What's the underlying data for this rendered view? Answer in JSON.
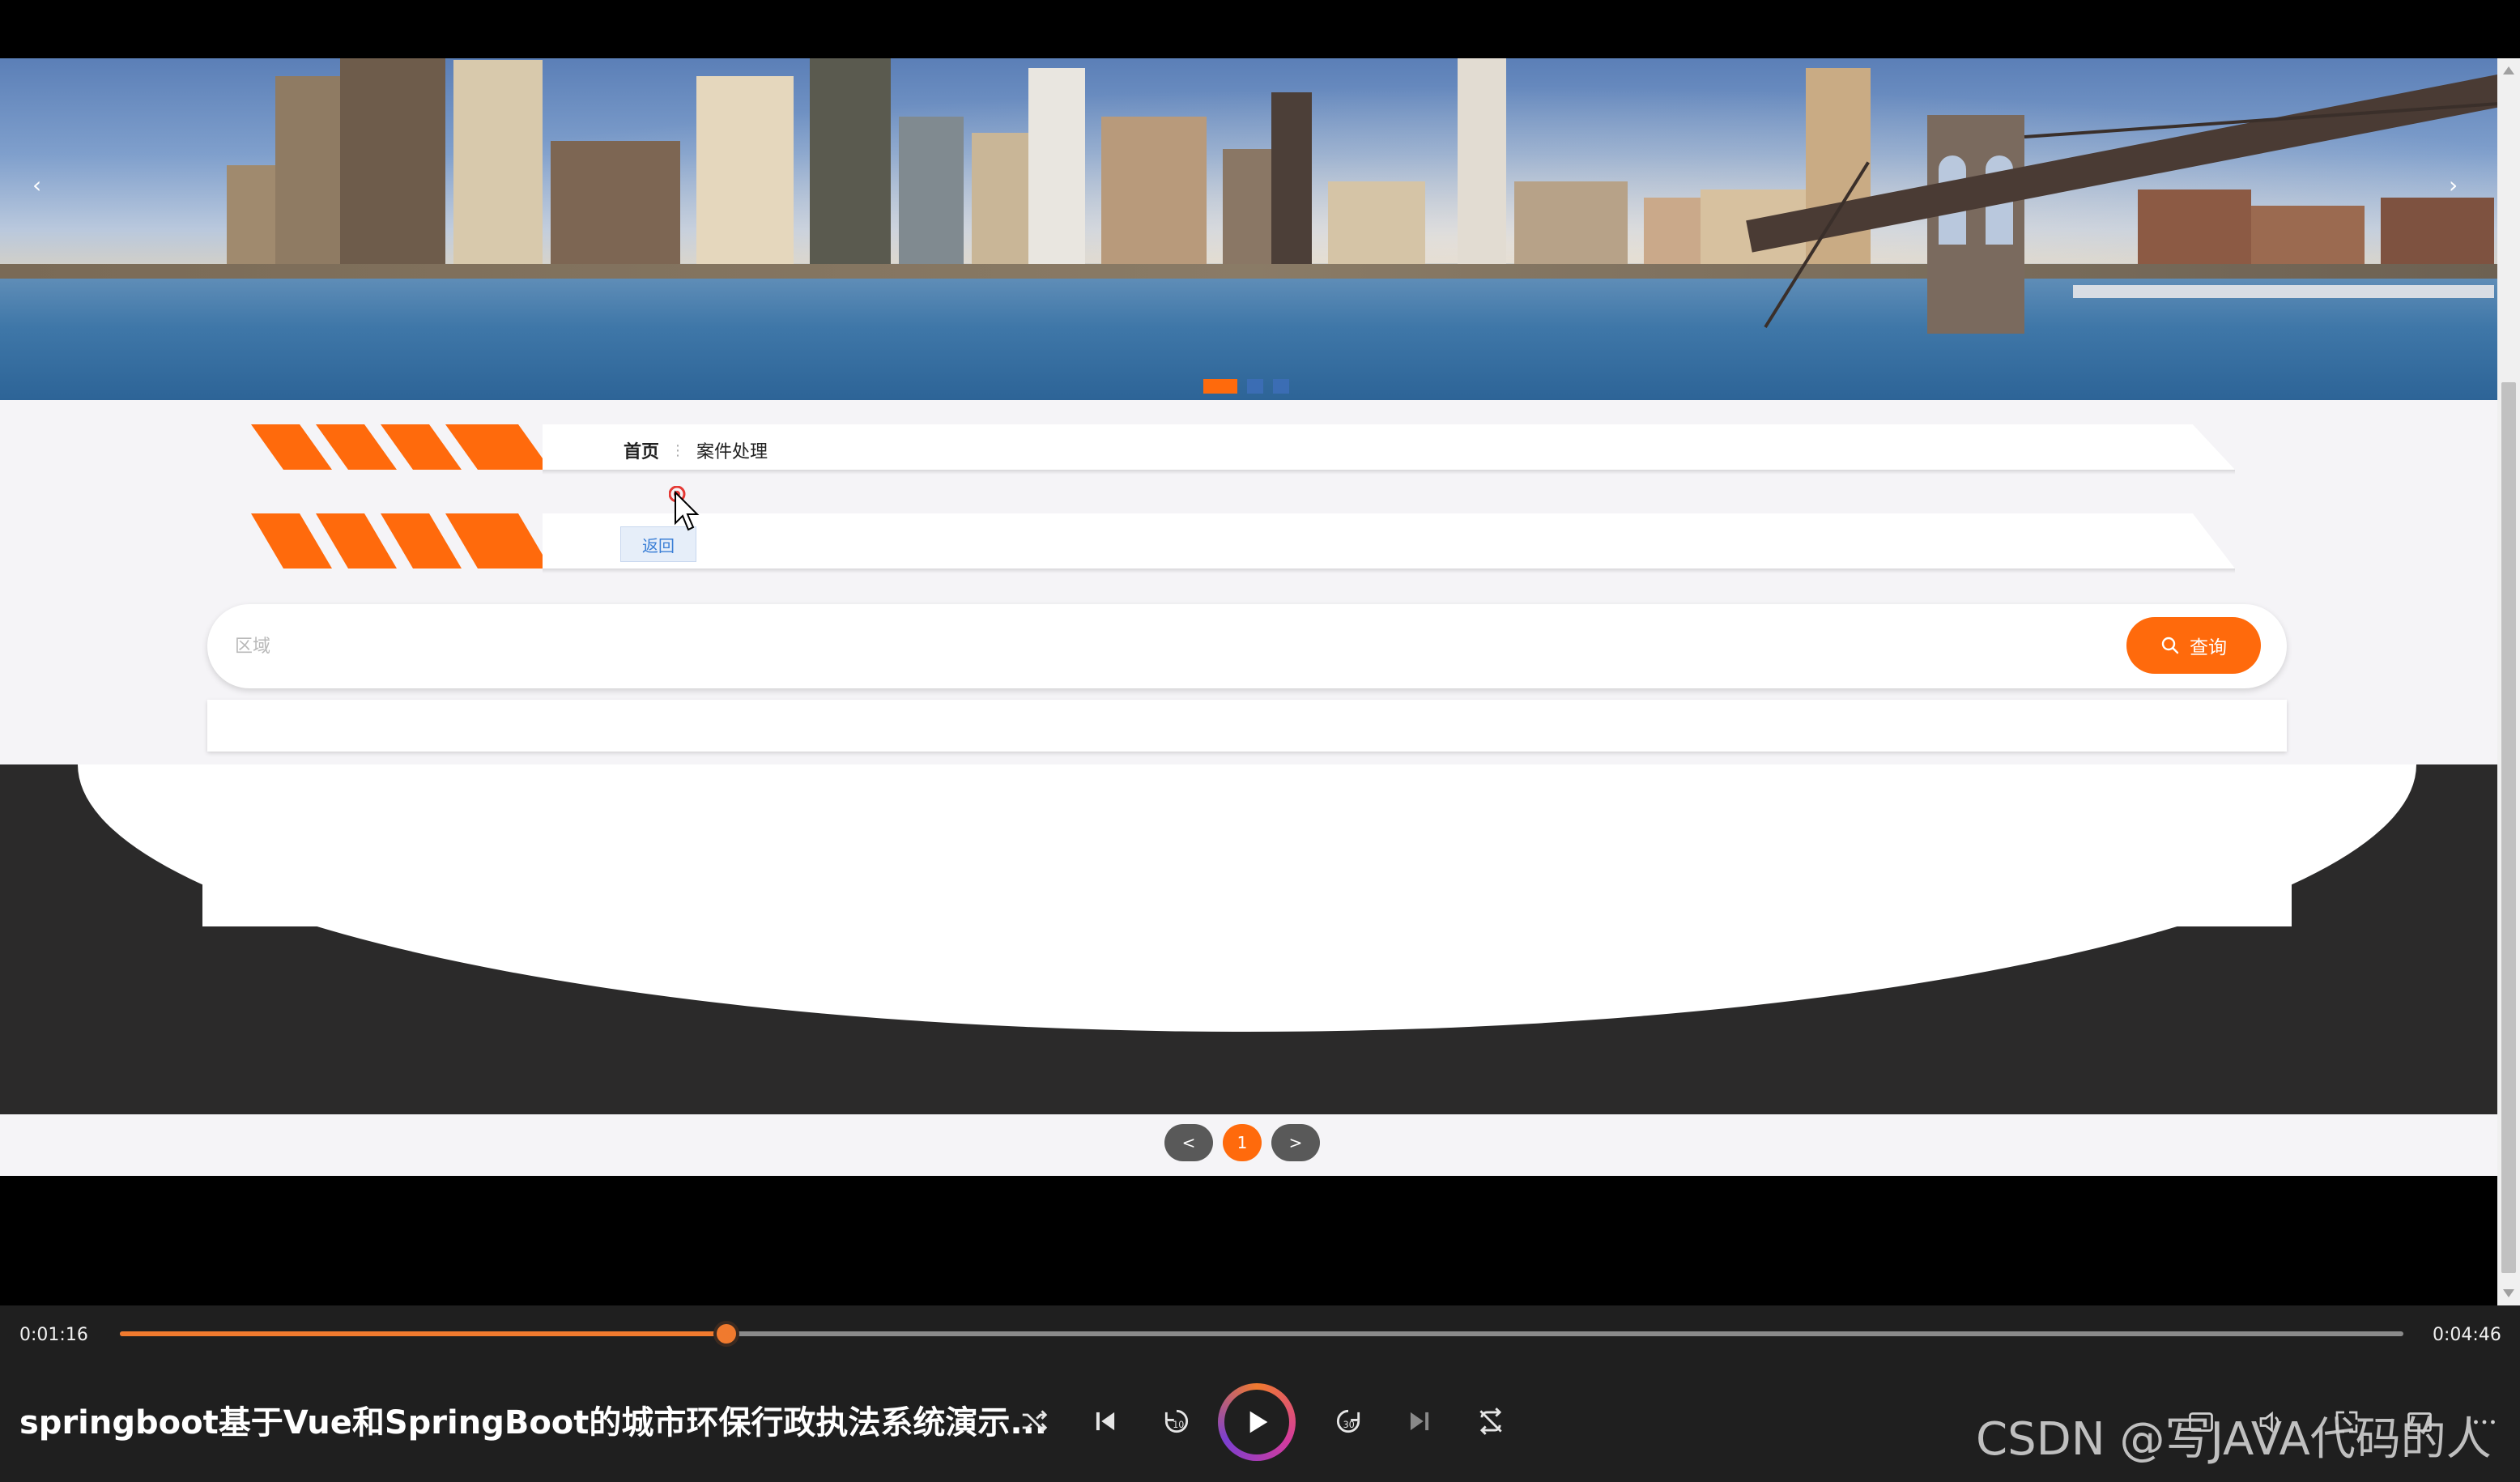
{
  "banner": {
    "prev_icon": "chevron-left-icon",
    "next_icon": "chevron-right-icon",
    "prev_symbol": "‹",
    "next_symbol": "›",
    "slides": 3,
    "active_slide": 1
  },
  "breadcrumb": {
    "home": "首页",
    "separator": "⋮",
    "current": "案件处理"
  },
  "toolbar": {
    "back_label": "返回"
  },
  "search": {
    "placeholder": "区域",
    "value": "",
    "button_label": "查询",
    "button_icon": "search-icon"
  },
  "pagination": {
    "prev": "<",
    "current_page": "1",
    "next": ">"
  },
  "player": {
    "elapsed": "0:01:16",
    "duration": "0:04:46",
    "progress": 0.2657,
    "title": "springboot基于Vue和SpringBoot的城市环保行政执法系统演示...",
    "watermark": "CSDN @写JAVA代码的人",
    "icons": [
      "shuffle-icon",
      "previous-icon",
      "rewind-10-icon",
      "play-icon",
      "forward-30-icon",
      "next-icon",
      "repeat-off-icon",
      "subtitles-icon",
      "volume-icon",
      "fullscreen-icon",
      "more-icon"
    ]
  },
  "colors": {
    "accent": "#ff6a0c",
    "dot_inactive": "#3b6db4",
    "player_bg": "#1f1f1f",
    "dark_section": "#2b2a2a"
  }
}
